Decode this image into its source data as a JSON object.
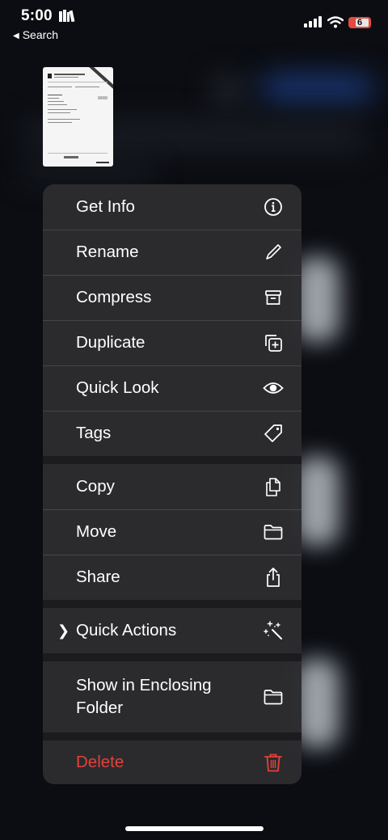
{
  "status_bar": {
    "time": "5:00",
    "back_label": "Search",
    "battery_level": "6"
  },
  "menu": {
    "group1": [
      {
        "label": "Get Info",
        "icon": "info-circle-icon"
      },
      {
        "label": "Rename",
        "icon": "pencil-icon"
      },
      {
        "label": "Compress",
        "icon": "archive-box-icon"
      },
      {
        "label": "Duplicate",
        "icon": "duplicate-plus-icon"
      },
      {
        "label": "Quick Look",
        "icon": "eye-icon"
      },
      {
        "label": "Tags",
        "icon": "tag-icon"
      }
    ],
    "group2": [
      {
        "label": "Copy",
        "icon": "copy-documents-icon"
      },
      {
        "label": "Move",
        "icon": "folder-icon"
      },
      {
        "label": "Share",
        "icon": "share-icon"
      }
    ],
    "group3": [
      {
        "label": "Quick Actions",
        "icon": "sparkle-wand-icon"
      }
    ],
    "group4": [
      {
        "label": "Show in Enclosing Folder",
        "icon": "folder-icon"
      }
    ],
    "group5": [
      {
        "label": "Delete",
        "icon": "trash-icon"
      }
    ]
  },
  "colors": {
    "menu_bg": "#2c2c30",
    "destructive": "#e5403a",
    "battery_low": "#e34a42"
  }
}
